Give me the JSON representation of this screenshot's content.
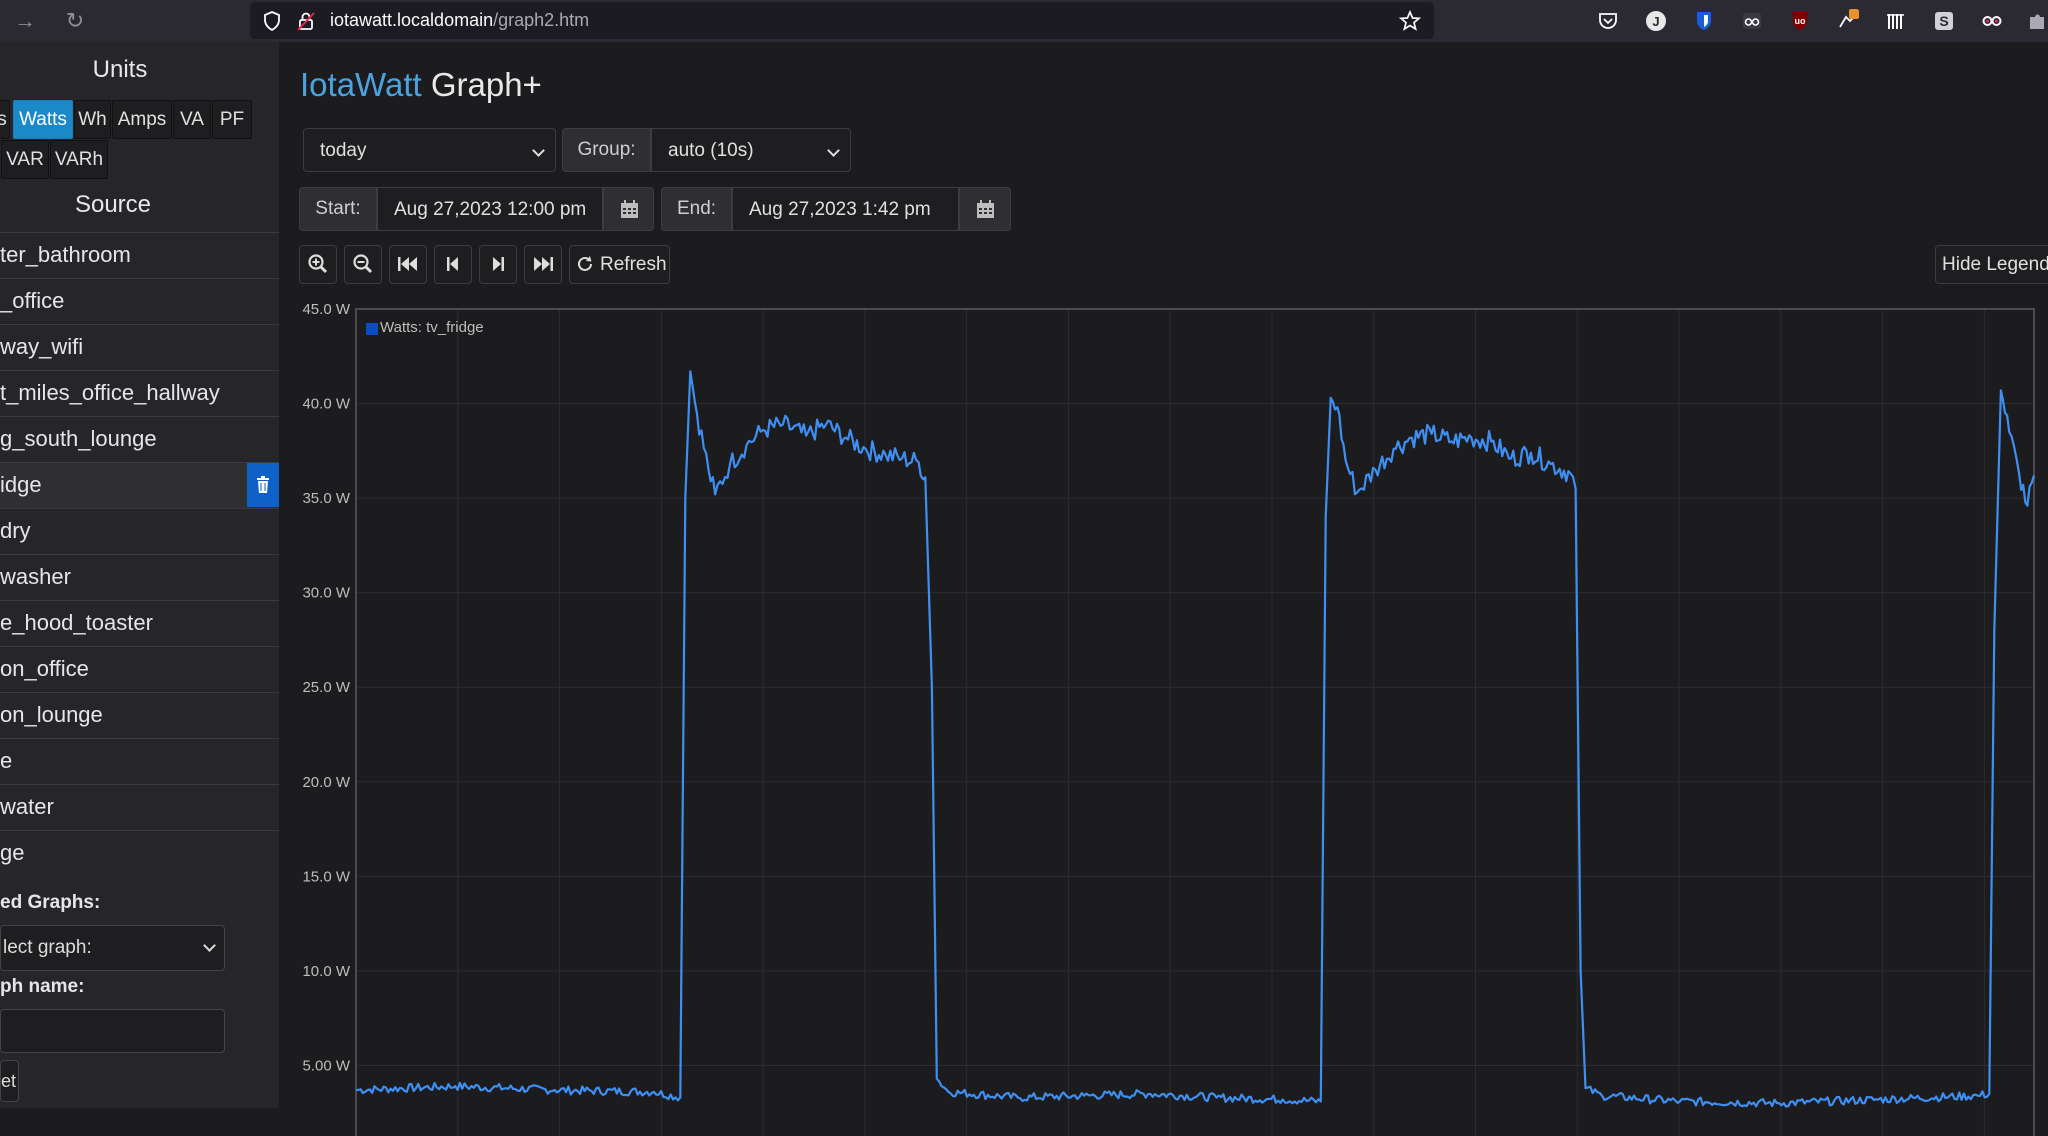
{
  "browser": {
    "url_host": "iotawatt.localdomain",
    "url_path": "/graph2.htm"
  },
  "sidebar": {
    "units_heading": "Units",
    "units_buttons": [
      "s",
      "Watts",
      "Wh",
      "Amps",
      "VA",
      "PF",
      "VAR",
      "VARh"
    ],
    "units_selected": "Watts",
    "source_heading": "Source",
    "sources": [
      "ter_bathroom",
      "_office",
      "way_wifi",
      "t_miles_office_hallway",
      "g_south_lounge",
      "idge",
      "dry",
      "washer",
      "e_hood_toaster",
      "on_office",
      "on_lounge",
      "e",
      "water",
      "ge"
    ],
    "selected_source": "idge",
    "saved_graphs_label": "ed Graphs:",
    "select_graph_placeholder": "lect graph:",
    "graph_name_label": "ph name:",
    "graph_name_value": "",
    "reset_label": "et"
  },
  "main": {
    "title_brand": "IotaWatt",
    "title_rest": " Graph+",
    "period_value": "today",
    "group_label": "Group:",
    "group_value": "auto (10s)",
    "start_label": "Start:",
    "start_value": "Aug 27,2023 12:00 pm",
    "end_label": "End:",
    "end_value": "Aug 27,2023 1:42 pm",
    "refresh_label": "Refresh",
    "hide_legend_label": "Hide Legend",
    "tool_icons": [
      "zoom-in-icon",
      "zoom-out-icon",
      "skip-start-icon",
      "step-back-icon",
      "step-forward-icon",
      "skip-end-icon",
      "refresh-icon"
    ]
  },
  "colors": {
    "accent": "#4aa3df",
    "active_unit": "#1989c8",
    "series_line": "#3f8ff2",
    "legend_swatch": "#0b4cc4",
    "trash": "#0d61c7"
  },
  "chart_data": {
    "type": "line",
    "title": "",
    "xlabel": "",
    "ylabel": "",
    "legend": "top-left",
    "grid": true,
    "ylim": [
      0,
      45
    ],
    "y_ticks": [
      "5.00 W",
      "10.0 W",
      "15.0 W",
      "20.0 W",
      "25.0 W",
      "30.0 W",
      "35.0 W",
      "40.0 W",
      "45.0 W"
    ],
    "x_start": "Aug 27,2023 12:00 pm",
    "x_end": "Aug 27,2023 1:42 pm",
    "x_unit": "minutes after start",
    "series": [
      {
        "name": "Watts: tv_fridge",
        "points": [
          [
            0,
            3.7
          ],
          [
            6,
            3.9
          ],
          [
            12,
            3.7
          ],
          [
            18,
            3.6
          ],
          [
            19.6,
            3.3
          ],
          [
            19.9,
            35.0
          ],
          [
            20.2,
            41.7
          ],
          [
            20.6,
            39.5
          ],
          [
            21.3,
            36.5
          ],
          [
            21.7,
            35.2
          ],
          [
            22.6,
            36.8
          ],
          [
            23.6,
            37.8
          ],
          [
            24.6,
            38.6
          ],
          [
            25.8,
            38.9
          ],
          [
            27.2,
            38.3
          ],
          [
            28.4,
            38.9
          ],
          [
            29.6,
            38.2
          ],
          [
            30.8,
            37.6
          ],
          [
            32.0,
            37.3
          ],
          [
            33.0,
            37.1
          ],
          [
            34.0,
            36.9
          ],
          [
            34.4,
            36.1
          ],
          [
            34.8,
            25.0
          ],
          [
            35.1,
            4.3
          ],
          [
            35.8,
            3.6
          ],
          [
            40,
            3.3
          ],
          [
            44,
            3.4
          ],
          [
            48,
            3.5
          ],
          [
            52,
            3.3
          ],
          [
            56,
            3.2
          ],
          [
            58.3,
            3.1
          ],
          [
            58.6,
            34.0
          ],
          [
            58.9,
            40.3
          ],
          [
            59.3,
            39.8
          ],
          [
            59.8,
            37.0
          ],
          [
            60.5,
            35.3
          ],
          [
            61.6,
            36.5
          ],
          [
            62.7,
            37.6
          ],
          [
            63.8,
            38.2
          ],
          [
            65.0,
            38.4
          ],
          [
            66.2,
            38.0
          ],
          [
            67.4,
            38.2
          ],
          [
            68.6,
            38.0
          ],
          [
            69.8,
            37.1
          ],
          [
            71.0,
            37.4
          ],
          [
            72.2,
            36.8
          ],
          [
            73.4,
            36.3
          ],
          [
            73.7,
            35.5
          ],
          [
            74.0,
            10.0
          ],
          [
            74.3,
            3.8
          ],
          [
            75.3,
            3.4
          ],
          [
            80,
            3.1
          ],
          [
            86,
            3.0
          ],
          [
            92,
            3.2
          ],
          [
            98,
            3.4
          ],
          [
            98.7,
            3.5
          ],
          [
            99.0,
            28.0
          ],
          [
            99.4,
            40.7
          ],
          [
            99.9,
            38.5
          ],
          [
            100.5,
            36.3
          ],
          [
            101.0,
            34.6
          ],
          [
            101.4,
            36.2
          ]
        ]
      }
    ]
  }
}
